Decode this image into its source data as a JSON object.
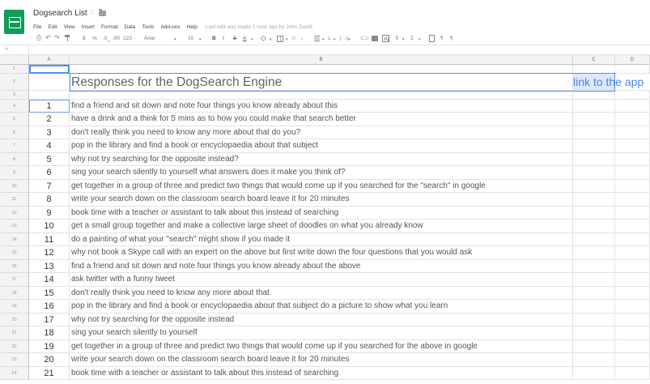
{
  "app": {
    "doc_title": "Dogsearch List",
    "icons": {
      "logo": "sheets-logo-icon",
      "star": "star-icon",
      "folder": "folder-icon"
    }
  },
  "menu": {
    "items": [
      "File",
      "Edit",
      "View",
      "Insert",
      "Format",
      "Data",
      "Tools",
      "Add-ons",
      "Help"
    ],
    "last_edit": "Last edit was made 1 hour ago by John Davitt"
  },
  "toolbar": {
    "currency": "$",
    "percent": "%",
    "decimal_decrease": ".0_",
    "decimal_increase": ".00",
    "more_formats": "123 -",
    "font": "Arial",
    "font_size": "10",
    "bold": "B",
    "italic": "I",
    "strikethrough": "S",
    "text_color": "A",
    "merge": "⊟",
    "valign": "⊥",
    "wrap": "|→|",
    "link": "⊂⊃",
    "filter": "⊽",
    "functions": "Σ",
    "ltr": "¶",
    "rtl": "¶",
    "caret": "▾"
  },
  "formula_bar": {
    "fx": "fx"
  },
  "columns": [
    "A",
    "B",
    "C",
    "D"
  ],
  "sheet": {
    "row_numbers": [
      "1",
      "2",
      "3",
      "4",
      "5",
      "6",
      "7",
      "8",
      "9",
      "10",
      "11",
      "12",
      "13",
      "14",
      "15",
      "16",
      "17",
      "18",
      "19",
      "20",
      "21",
      "22",
      "23",
      "24"
    ],
    "heading": "Responses for the DogSearch Engine",
    "link_text": "link to the app",
    "rows": [
      {
        "n": "1",
        "text": "find a friend and sit down and note four things you know already about this"
      },
      {
        "n": "2",
        "text": "have a drink and a think for 5 mins as to how you could make that search better"
      },
      {
        "n": "3",
        "text": "don't really think you need to know any more about that do you?"
      },
      {
        "n": "4",
        "text": "pop in the library and find a book or encyclopaedia about that subject"
      },
      {
        "n": "5",
        "text": "why not try searching for the opposite instead?"
      },
      {
        "n": "6",
        "text": "sing your search silently to yourself what answers does it make you think of?"
      },
      {
        "n": "7",
        "text": "get together in a group of three and predict two things that would come up if you searched for the \"search\" in google"
      },
      {
        "n": "8",
        "text": "write your search down on the classroom search board leave it for 20 minutes"
      },
      {
        "n": "9",
        "text": "book time with a teacher or assistant to talk about this instead of searching"
      },
      {
        "n": "10",
        "text": "get a small group together and make a collective large sheet of doodles on what you already know"
      },
      {
        "n": "11",
        "text": "do a painting of what your \"search\" might show if you made it"
      },
      {
        "n": "12",
        "text": "why not book a Skype call with an expert on the above but first write down the four questions that you would ask"
      },
      {
        "n": "13",
        "text": "find a friend and sit down and note four things you know already about the above"
      },
      {
        "n": "14",
        "text": "ask twitter with a funny tweet"
      },
      {
        "n": "15",
        "text": "don't really think you need to know any more about that"
      },
      {
        "n": "16",
        "text": "pop in the library and find a book or encyclopaedia about that subject do a picture to show what you learn"
      },
      {
        "n": "17",
        "text": "why not try searching for the opposite instead"
      },
      {
        "n": "18",
        "text": "sing your search silently to yourself"
      },
      {
        "n": "19",
        "text": "get together in a group of three and predict two things that would come up if you searched for the above in google"
      },
      {
        "n": "20",
        "text": "write your search down on the classroom search board leave it for 20 minutes"
      },
      {
        "n": "21",
        "text": "book time with a teacher or assistant to talk about this instead of searching"
      }
    ]
  },
  "colors": {
    "logo": "#0f9d58",
    "link": "#4a86e8",
    "selection": "#4d90fe"
  }
}
